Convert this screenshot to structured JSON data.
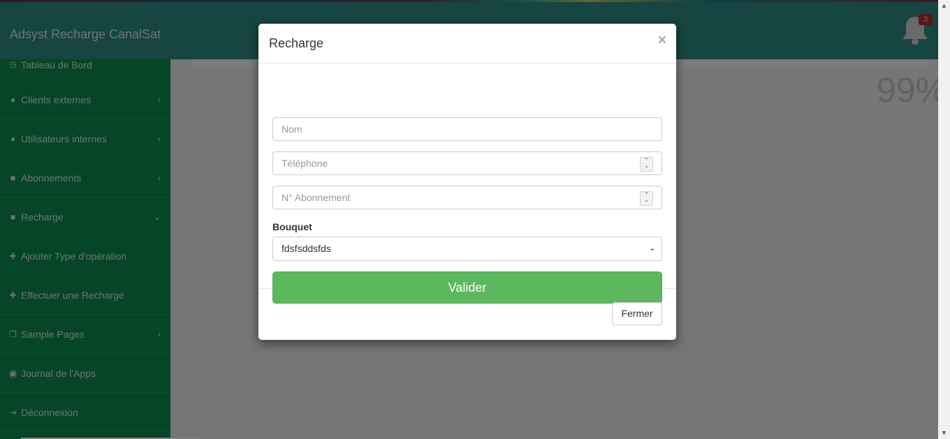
{
  "header": {
    "brand": "Adsyst Recharge CanalSat",
    "notification_count": "3"
  },
  "sidebar": {
    "items": [
      {
        "label": "Tableau de Bord",
        "icon": "dashboard-icon"
      },
      {
        "label": "Clients externes",
        "icon": "users-icon"
      },
      {
        "label": "Utilisateurs internes",
        "icon": "users-icon"
      },
      {
        "label": "Abonnements",
        "icon": "briefcase-icon"
      },
      {
        "label": "Recharge",
        "icon": "briefcase-icon"
      },
      {
        "label": "Ajouter Type d'opération",
        "icon": "plus-icon"
      },
      {
        "label": "Effectuer une Recharge",
        "icon": "plus-icon"
      },
      {
        "label": "Sample Pages",
        "icon": "copy-icon"
      },
      {
        "label": "Journal de l'Apps",
        "icon": "save-icon"
      },
      {
        "label": "Déconnexion",
        "icon": "sign-out-icon"
      }
    ]
  },
  "main": {
    "percent": "99%"
  },
  "modal": {
    "title": "Recharge",
    "close": "×",
    "fields": {
      "nom_placeholder": "Nom",
      "telephone_placeholder": "Téléphone",
      "abonnement_placeholder": "N° Abonnement"
    },
    "bouquet_label": "Bouquet",
    "bouquet_selected": "fdsfsddsfds",
    "submit_label": "Valider",
    "close_label": "Fermer"
  },
  "colors": {
    "header": "#2e8a82",
    "sidebar": "#0d8a4e",
    "success": "#5cb85c",
    "badge": "#b52b2b"
  }
}
